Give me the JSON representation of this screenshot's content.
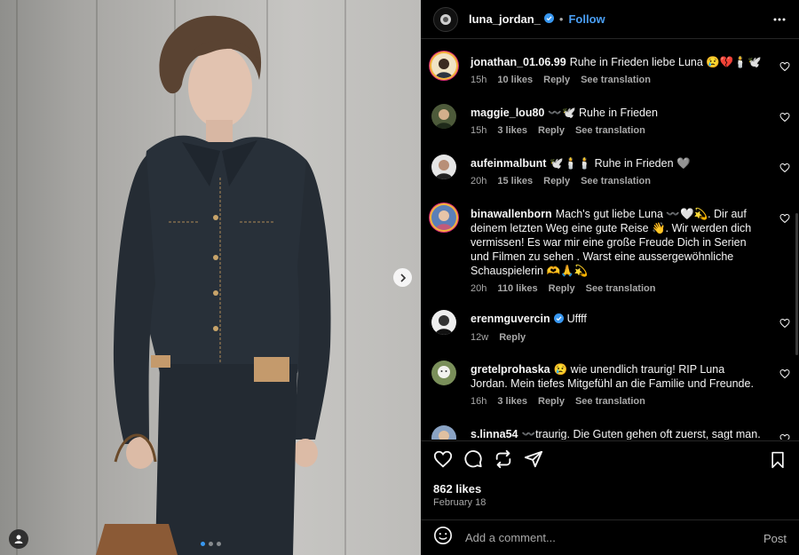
{
  "post": {
    "username": "luna_jordan_",
    "separator": "•",
    "follow_label": "Follow",
    "likes": "862 likes",
    "date": "February 18",
    "add_comment_placeholder": "Add a comment...",
    "post_label": "Post"
  },
  "colors": {
    "accent": "#4a9ff5",
    "muted": "#a8a8a8",
    "background": "#000000"
  },
  "icons": {
    "header": [
      "avatar-icon",
      "verified-badge-icon",
      "more-options-icon"
    ],
    "actions": [
      "heart-icon",
      "comment-icon",
      "share-icon",
      "send-icon",
      "bookmark-icon"
    ],
    "photo": [
      "chevron-right-icon",
      "user-tag-icon"
    ],
    "composer": [
      "emoji-icon"
    ]
  },
  "carousel": {
    "total": 3,
    "active": 1
  },
  "comments": [
    {
      "user": "jonathan_01.06.99",
      "text": "Ruhe in Frieden liebe Luna 😢💔🕯️🕊️",
      "time": "15h",
      "likes": "10 likes",
      "reply": "Reply",
      "translate": "See translation"
    },
    {
      "user": "maggie_lou80",
      "text": "〰️🕊️ Ruhe in Frieden",
      "time": "15h",
      "likes": "3 likes",
      "reply": "Reply",
      "translate": "See translation"
    },
    {
      "user": "aufeinmalbunt",
      "text": "🕊️🕯️🕯️ Ruhe in Frieden 🩶",
      "time": "20h",
      "likes": "15 likes",
      "reply": "Reply",
      "translate": "See translation"
    },
    {
      "user": "binawallenborn",
      "text": "Mach's gut liebe Luna 〰️🤍💫. Dir auf deinem letzten Weg eine gute Reise 👋. Wir werden dich vermissen! Es war mir eine große Freude Dich in Serien und Filmen zu sehen . Warst eine aussergewöhnliche Schauspielerin 🫶🙏💫",
      "time": "20h",
      "likes": "110 likes",
      "reply": "Reply",
      "translate": "See translation"
    },
    {
      "user": "erenmguvercin",
      "text": "Uffff",
      "time": "12w",
      "likes": "",
      "reply": "Reply",
      "translate": ""
    },
    {
      "user": "gretelprohaska",
      "text": "😢 wie unendlich traurig! RIP Luna Jordan. Mein tiefes Mitgefühl an die Familie und Freunde.",
      "time": "16h",
      "likes": "3 likes",
      "reply": "Reply",
      "translate": "See translation"
    },
    {
      "user": "s.linna54",
      "text": "〰️traurig. Die Guten gehen oft zuerst, sagt man.",
      "time": "",
      "likes": "",
      "reply": "",
      "translate": ""
    }
  ]
}
